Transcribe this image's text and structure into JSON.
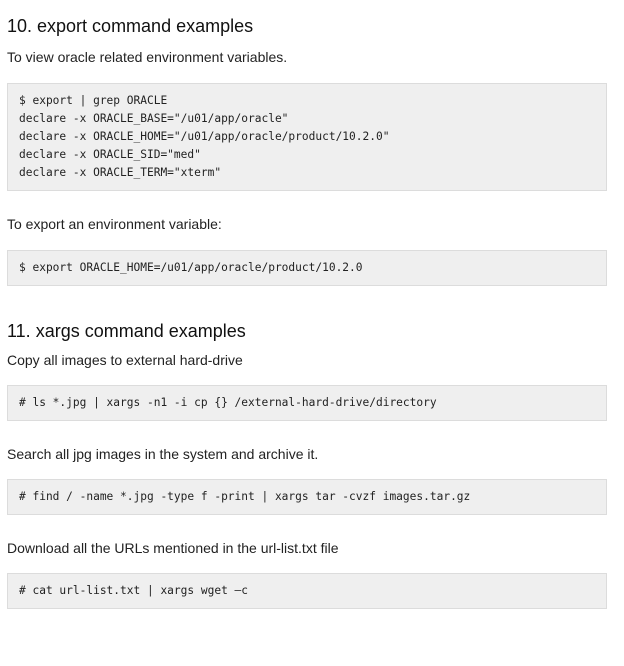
{
  "sections": [
    {
      "heading": "10. export command examples",
      "blocks": [
        {
          "type": "text",
          "text": "To view oracle related environment variables."
        },
        {
          "type": "code",
          "lines": [
            "$ export | grep ORACLE",
            "declare -x ORACLE_BASE=\"/u01/app/oracle\"",
            "declare -x ORACLE_HOME=\"/u01/app/oracle/product/10.2.0\"",
            "declare -x ORACLE_SID=\"med\"",
            "declare -x ORACLE_TERM=\"xterm\""
          ]
        },
        {
          "type": "text",
          "text": "To export an environment variable:"
        },
        {
          "type": "code",
          "lines": [
            "$ export ORACLE_HOME=/u01/app/oracle/product/10.2.0"
          ]
        }
      ]
    },
    {
      "heading": "11. xargs command examples",
      "blocks": [
        {
          "type": "text",
          "text": "Copy all images to external hard-drive"
        },
        {
          "type": "code",
          "lines": [
            "# ls *.jpg | xargs -n1 -i cp {} /external-hard-drive/directory"
          ]
        },
        {
          "type": "text",
          "text": "Search all jpg images in the system and archive it."
        },
        {
          "type": "code",
          "lines": [
            "# find / -name *.jpg -type f -print | xargs tar -cvzf images.tar.gz"
          ]
        },
        {
          "type": "text",
          "text": "Download all the URLs mentioned in the url-list.txt file"
        },
        {
          "type": "code",
          "lines": [
            "# cat url-list.txt | xargs wget –c"
          ]
        }
      ]
    }
  ]
}
